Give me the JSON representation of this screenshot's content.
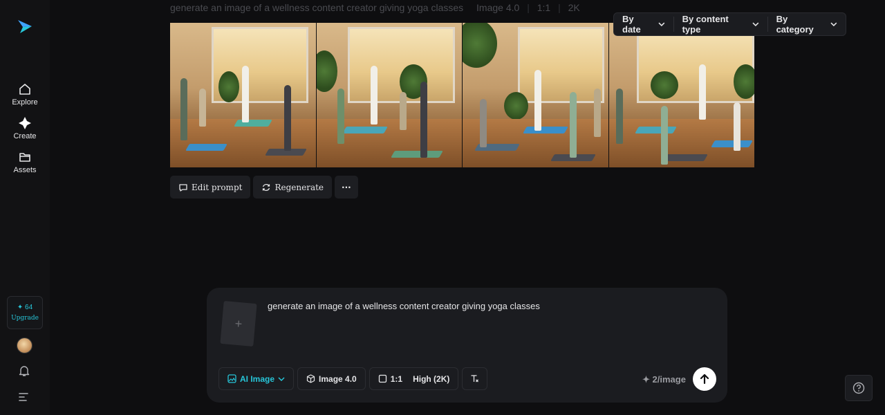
{
  "sidebar": {
    "items": [
      {
        "label": "Explore",
        "icon": "home-icon"
      },
      {
        "label": "Create",
        "icon": "sparkle-icon"
      },
      {
        "label": "Assets",
        "icon": "folder-icon"
      }
    ],
    "credits": {
      "count": "64",
      "upgrade_label": "Upgrade"
    }
  },
  "header": {
    "prompt": "generate an image of a wellness content creator giving yoga classes",
    "model": "Image 4.0",
    "ratio": "1:1",
    "resolution": "2K"
  },
  "filters": [
    {
      "label": "By date"
    },
    {
      "label": "By content type"
    },
    {
      "label": "By category"
    }
  ],
  "actions": {
    "edit_label": "Edit prompt",
    "regenerate_label": "Regenerate",
    "more_label": "···"
  },
  "composer": {
    "upload_symbol": "+",
    "prompt": "generate an image of a wellness content creator giving yoga classes",
    "mode_label": "AI Image",
    "model_label": "Image 4.0",
    "ratio_label": "1:1",
    "quality_label": "High (2K)",
    "cost_label": "2/image"
  },
  "colors": {
    "accent": "#27c6d9",
    "background": "#0e0e10",
    "panel": "#1b1c20"
  }
}
